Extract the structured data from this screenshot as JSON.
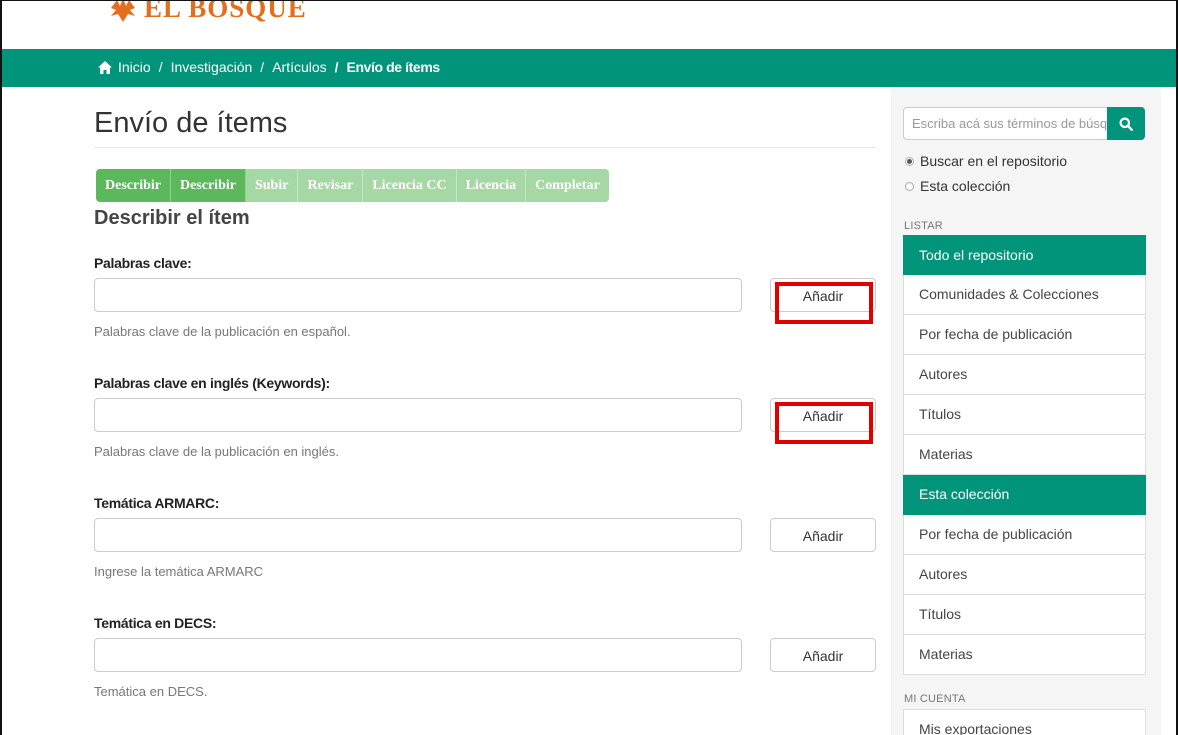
{
  "header": {
    "logo_text": "EL BOSQUE",
    "breadcrumb": {
      "home": "Inicio",
      "research": "Investigación",
      "articles": "Artículos",
      "current": "Envío de ítems",
      "separator": "/"
    }
  },
  "main": {
    "title": "Envío de ítems",
    "steps": [
      {
        "label": "Describir",
        "state": "done"
      },
      {
        "label": "Describir",
        "state": "done"
      },
      {
        "label": "Subir",
        "state": "todo"
      },
      {
        "label": "Revisar",
        "state": "todo"
      },
      {
        "label": "Licencia CC",
        "state": "todo"
      },
      {
        "label": "Licencia",
        "state": "todo"
      },
      {
        "label": "Completar",
        "state": "todo"
      }
    ],
    "section_title": "Describir el ítem",
    "fields": [
      {
        "label": "Palabras clave:",
        "value": "",
        "button": "Añadir",
        "help": "Palabras clave de la publicación en español."
      },
      {
        "label": "Palabras clave en inglés (Keywords):",
        "value": "",
        "button": "Añadir",
        "help": "Palabras clave de la publicación en inglés."
      },
      {
        "label": "Temática ARMARC:",
        "value": "",
        "button": "Añadir",
        "help": "Ingrese la temática ARMARC"
      },
      {
        "label": "Temática en DECS:",
        "value": "",
        "button": "Añadir",
        "help": "Temática en DECS."
      }
    ]
  },
  "sidebar": {
    "search_placeholder": "Escriba acá sus términos de búsqueda",
    "scope_options": [
      {
        "label": "Buscar en el repositorio",
        "checked": true
      },
      {
        "label": "Esta colección",
        "checked": false
      }
    ],
    "browse_heading": "LISTAR",
    "browse_repo": {
      "header": "Todo el repositorio",
      "items": [
        "Comunidades & Colecciones",
        "Por fecha de publicación",
        "Autores",
        "Títulos",
        "Materias"
      ]
    },
    "browse_collection": {
      "header": "Esta colección",
      "items": [
        "Por fecha de publicación",
        "Autores",
        "Títulos",
        "Materias"
      ]
    },
    "account_heading": "MI CUENTA",
    "account_items": [
      "Mis exportaciones"
    ]
  },
  "colors": {
    "brand_green": "#00957a",
    "step_done": "#5cb85c",
    "step_todo": "#a6d8a6",
    "logo_orange": "#e36f1e",
    "highlight_red": "#e00000"
  }
}
